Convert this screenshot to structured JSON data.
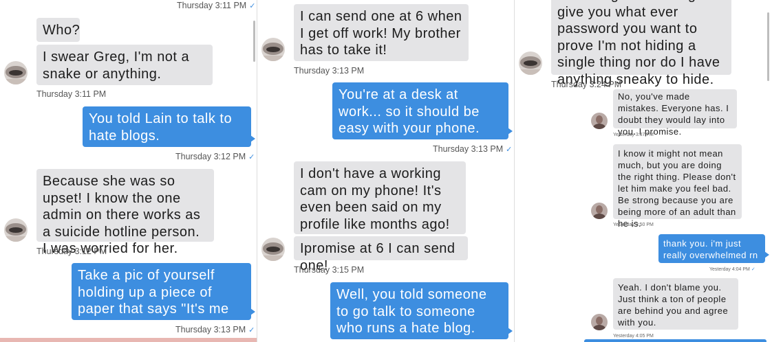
{
  "panel1": {
    "messages": [
      {
        "text": "Who?"
      },
      {
        "text": "I swear Greg, I'm not a snake or anything."
      },
      {
        "text": "You told Lain to talk to hate blogs."
      },
      {
        "text": "Because she was so upset! I know the one admin on there works as a suicide hotline person. I was worried for her."
      },
      {
        "text": "Take a pic of yourself holding up a piece of paper that says \"It's me Greg\" and send it."
      }
    ],
    "timestamps": [
      "Thursday 3:11 PM",
      "Thursday 3:11 PM",
      "Thursday 3:12 PM",
      "Thursday 3:12 PM",
      "Thursday 3:13 PM"
    ]
  },
  "panel2": {
    "messages": [
      {
        "text": "I can send one at 6 when I get off work! My brother has to take it!"
      },
      {
        "text": "You're at a desk at work... so it should be easy with your phone."
      },
      {
        "text": "I don't have a working cam on my phone! It's even been said on my profile like months ago!"
      },
      {
        "text": "Ipromise at 6 I can send one!"
      },
      {
        "text": "Well, you told someone to go talk to someone who runs a hate blog. That's gross. Bye."
      }
    ],
    "timestamps": [
      "Thursday 3:13 PM",
      "Thursday 3:13 PM",
      "Thursday 3:15 PM"
    ]
  },
  "panel3": {
    "messages": [
      {
        "text": "I'm sitting here willing to give you what ever password you want to prove I'm not hiding a single thing nor do I have anything sneaky to hide."
      },
      {
        "text": "No, you've made mistakes. Everyone has. I doubt they would lay into you. I promise."
      },
      {
        "text": "I know it might not mean much, but you are doing the right thing. Please don't let him make you feel bad. Be strong because you are being more of an adult than he is."
      },
      {
        "text": "thank you. i'm just really overwhelmed rn"
      },
      {
        "text": "Yeah. I don't blame you. Just think a ton of people are behind you and agree with you."
      }
    ],
    "timestamps": [
      "Thursday 3:24 PM",
      "Yesterday 3:37 PM",
      "Yesterday 3:50 PM",
      "Yesterday 4:04 PM",
      "Yesterday 4:05 PM"
    ]
  },
  "icons": {
    "read_receipt": "checkmark-icon",
    "avatar": "contact-avatar"
  },
  "colors": {
    "outgoing_bubble": "#3d8ee0",
    "incoming_bubble": "#e4e4e6",
    "read_check": "#3d8ee0"
  }
}
